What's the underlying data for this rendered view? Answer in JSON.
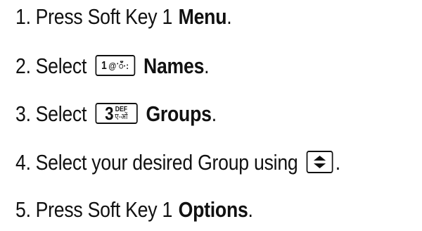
{
  "steps": [
    {
      "number": "1.",
      "text": "Press  Soft Key 1",
      "bold": "Menu",
      "suffix": "."
    },
    {
      "number": "2.",
      "text": "Select",
      "key": {
        "digit": "1",
        "symbols": "@ॱँ·:"
      },
      "bold": "Names",
      "suffix": "."
    },
    {
      "number": "3.",
      "text": "Select",
      "key": {
        "digit": "3",
        "top": "DEF",
        "bottom": "ए-ओं"
      },
      "bold": "Groups",
      "suffix": "."
    },
    {
      "number": "4.",
      "text": "Select your desired Group using",
      "key_icon": "up-down-navigation-key-icon",
      "suffix": "."
    },
    {
      "number": "5.",
      "text": "Press Soft Key 1",
      "bold": "Options",
      "suffix": "."
    }
  ]
}
